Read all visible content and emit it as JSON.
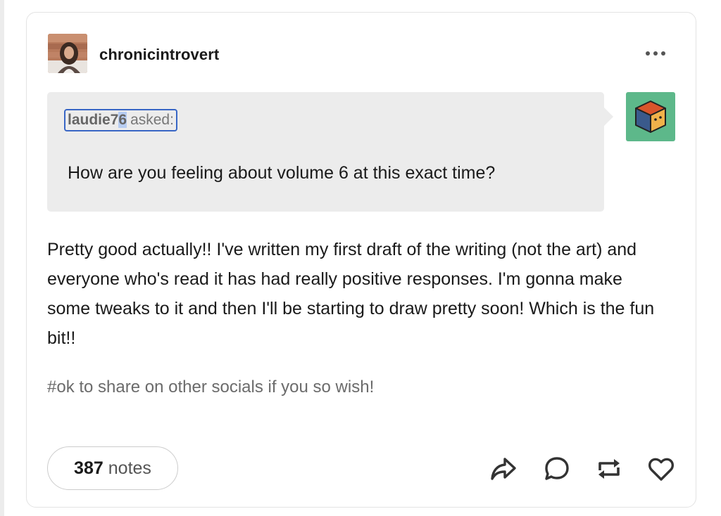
{
  "post": {
    "username": "chronicintrovert",
    "ask": {
      "asker": "laudie76",
      "asker_prefix": "laudie7",
      "asker_selected": "6",
      "asked_label": "asked:",
      "question": "How are you feeling about volume 6 at this exact time?"
    },
    "answer": "Pretty good actually!! I've written my first draft of the writing (not the art) and everyone who's read it has had really positive responses. I'm gonna make some tweaks to it and then I'll be starting to draw pretty soon! Which is the fun bit!!",
    "tags": [
      "#ok to share on other socials if you so wish!"
    ],
    "notes": {
      "count": "387",
      "label": "notes"
    }
  },
  "icons": {
    "more": "more-options-icon",
    "share": "share-icon",
    "reply": "reply-icon",
    "reblog": "reblog-icon",
    "like": "heart-icon",
    "asker_avatar": "cube-avatar-icon"
  },
  "colors": {
    "selection_border": "#3866c5",
    "ask_bubble_bg": "#ececec",
    "asker_avatar_bg": "#5db88a"
  }
}
